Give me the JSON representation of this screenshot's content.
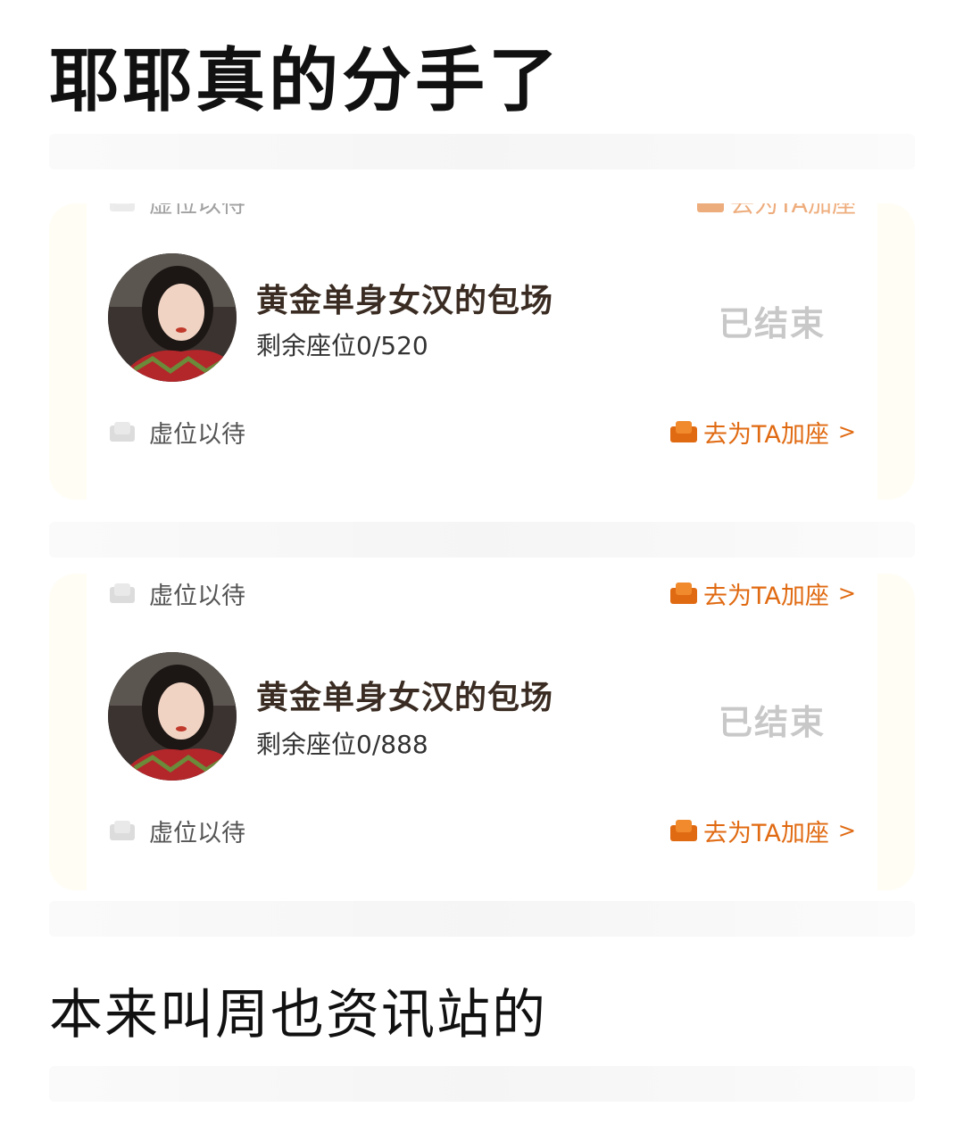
{
  "headline": "耶耶真的分手了",
  "footer_text": "本来叫周也资讯站的",
  "cards": [
    {
      "top_pending_label": "虚位以待",
      "top_add_label": "去为TA加座",
      "title": "黄金单身女汉的包场",
      "seats": "剩余座位0/520",
      "status": "已结束",
      "pending_label": "虚位以待",
      "add_label": "去为TA加座",
      "chevron": ">"
    },
    {
      "top_pending_label": "虚位以待",
      "top_add_label": "去为TA加座",
      "title": "黄金单身女汉的包场",
      "seats": "剩余座位0/888",
      "status": "已结束",
      "pending_label": "虚位以待",
      "add_label": "去为TA加座",
      "chevron": ">"
    }
  ],
  "colors": {
    "accent_orange": "#e06a12",
    "ended_gray": "#c8c8c8",
    "title_brown": "#3a2c22",
    "card_border": "#fffdf4"
  },
  "icons": {
    "pending": "sofa-gray-icon",
    "add": "sofa-orange-icon"
  }
}
